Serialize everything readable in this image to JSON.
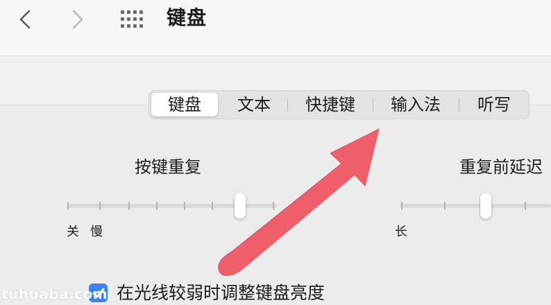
{
  "window": {
    "title": "键盘"
  },
  "toolbar": {
    "back_icon": "chevron-left-icon",
    "forward_icon": "chevron-right-icon",
    "grid_icon": "grid-icon"
  },
  "tabs": [
    {
      "label": "键盘",
      "selected": true
    },
    {
      "label": "文本",
      "selected": false
    },
    {
      "label": "快捷键",
      "selected": false
    },
    {
      "label": "输入法",
      "selected": false
    },
    {
      "label": "听写",
      "selected": false
    }
  ],
  "key_repeat": {
    "label": "按键重复",
    "min_label": "关",
    "slow_label": "慢",
    "position_fraction": 0.8
  },
  "delay_until_repeat": {
    "label": "重复前延迟",
    "long_label": "长",
    "position_fraction": 0.3
  },
  "brightness_option": {
    "label": "在光线较弱时调整键盘亮度",
    "checked": true
  },
  "annotation": {
    "type": "arrow",
    "color": "#ef5f6b",
    "points_to": "输入法"
  },
  "watermark": "tuhuaba.com",
  "colors": {
    "accent": "#3d83f6",
    "arrow": "#ef5f6b"
  }
}
